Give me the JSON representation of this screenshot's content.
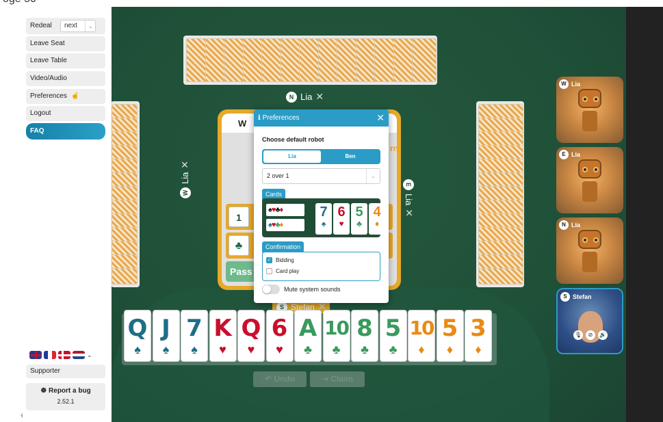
{
  "top_strip_text": "oge 50",
  "sidebar": {
    "redeal_label": "Redeal",
    "next_value": "next",
    "leave_seat": "Leave Seat",
    "leave_table": "Leave Table",
    "video_audio": "Video/Audio",
    "preferences": "Preferences",
    "logout": "Logout",
    "faq": "FAQ",
    "supporter": "Supporter",
    "report_bug": "Report a bug",
    "version": "2.52.1"
  },
  "seats": {
    "north": {
      "dir": "N",
      "name": "Lia"
    },
    "west": {
      "dir": "W",
      "name": "Lia"
    },
    "east": {
      "dir": "E",
      "name": "Lia"
    },
    "south": {
      "dir": "S",
      "name": "Stefan"
    }
  },
  "video_tiles": [
    {
      "dir": "W",
      "name": "Lia"
    },
    {
      "dir": "E",
      "name": "Lia"
    },
    {
      "dir": "N",
      "name": "Lia"
    },
    {
      "dir": "S",
      "name": "Stefan"
    }
  ],
  "bidding_box": {
    "header_dir": "W",
    "side_fragment": "rn",
    "level_1": "1",
    "club": "♣",
    "pass": "Pass"
  },
  "hand": [
    {
      "rank": "Q",
      "suit": "♠",
      "color": "#1f6e87"
    },
    {
      "rank": "J",
      "suit": "♠",
      "color": "#1f6e87"
    },
    {
      "rank": "7",
      "suit": "♠",
      "color": "#1f6e87"
    },
    {
      "rank": "K",
      "suit": "♥",
      "color": "#c8102e"
    },
    {
      "rank": "Q",
      "suit": "♥",
      "color": "#c8102e"
    },
    {
      "rank": "6",
      "suit": "♥",
      "color": "#c8102e"
    },
    {
      "rank": "A",
      "suit": "♣",
      "color": "#3a9a5c"
    },
    {
      "rank": "10",
      "suit": "♣",
      "color": "#3a9a5c"
    },
    {
      "rank": "8",
      "suit": "♣",
      "color": "#3a9a5c"
    },
    {
      "rank": "5",
      "suit": "♣",
      "color": "#3a9a5c"
    },
    {
      "rank": "10",
      "suit": "♦",
      "color": "#e98a12"
    },
    {
      "rank": "5",
      "suit": "♦",
      "color": "#e98a12"
    },
    {
      "rank": "3",
      "suit": "♦",
      "color": "#e98a12"
    }
  ],
  "actions": {
    "undo": "Undo",
    "claim": "Claim"
  },
  "preferences_modal": {
    "title": "Preferences",
    "choose_robot": "Choose default robot",
    "robot_options": [
      "Lia",
      "Ben"
    ],
    "selected_robot": "Lia",
    "system_value": "2 over 1",
    "cards_tab": "Cards",
    "suit_style_a": "♠♥♣♦",
    "suit_style_b": "♠♥♣♦",
    "preview_cards": [
      {
        "rank": "7",
        "suit": "♠",
        "color": "#1f6e87"
      },
      {
        "rank": "6",
        "suit": "♥",
        "color": "#c8102e"
      },
      {
        "rank": "5",
        "suit": "♣",
        "color": "#3a9a5c"
      },
      {
        "rank": "4",
        "suit": "♦",
        "color": "#e98a12"
      }
    ],
    "confirmation_tab": "Confirmation",
    "bidding_label": "Bidding",
    "bidding_checked": true,
    "cardplay_label": "Card play",
    "cardplay_checked": false,
    "mute_label": "Mute system sounds",
    "mute_on": false
  }
}
